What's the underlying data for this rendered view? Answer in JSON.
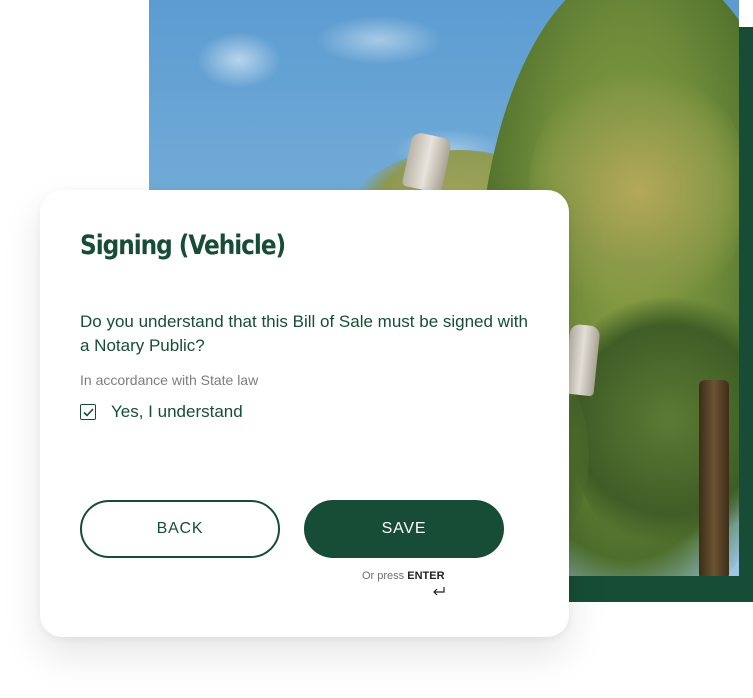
{
  "form": {
    "title": "Signing (Vehicle)",
    "question": "Do you understand that this Bill of Sale must be signed with a Notary Public?",
    "hint": "In accordance with State law",
    "checkbox_label": "Yes, I understand",
    "checkbox_checked": true
  },
  "actions": {
    "back_label": "BACK",
    "save_label": "SAVE",
    "enter_prefix": "Or press",
    "enter_key": "ENTER"
  },
  "colors": {
    "brand": "#174d37",
    "hint_text": "#7d7d7d"
  },
  "icons": {
    "checkbox": "checkmark-icon",
    "enter": "enter-return-icon"
  }
}
